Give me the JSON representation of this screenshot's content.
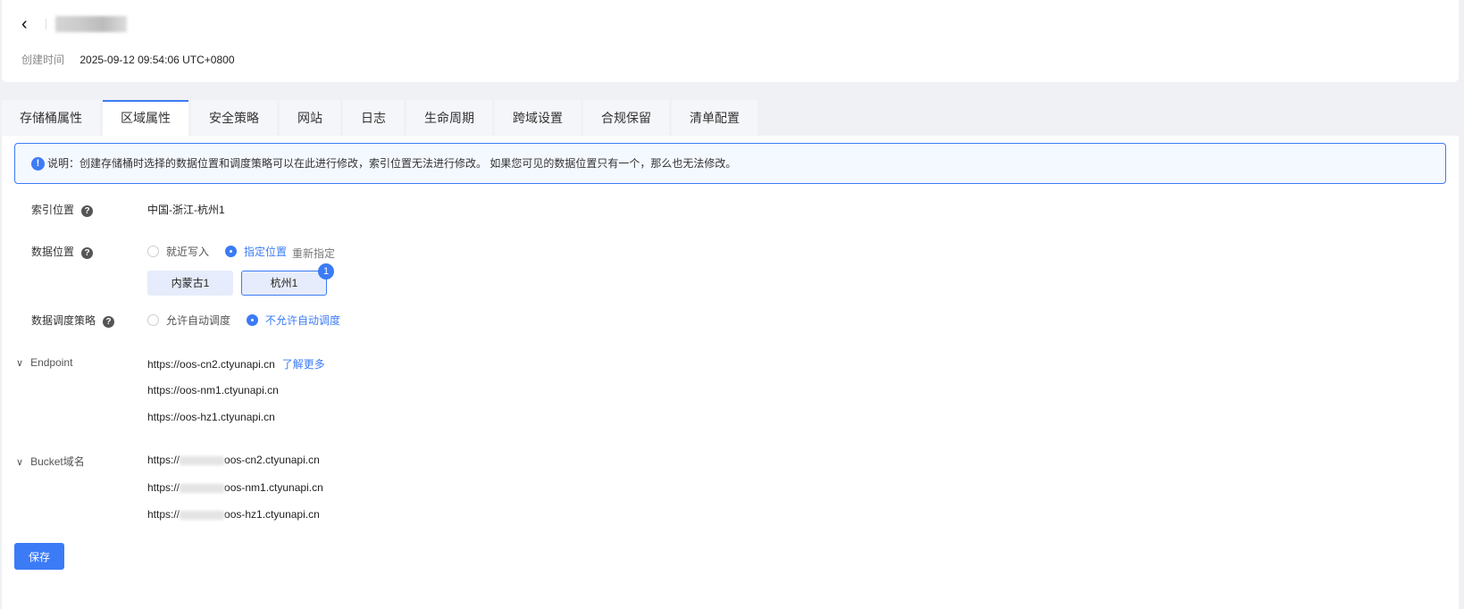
{
  "header": {
    "back_label": "<",
    "created_label": "创建时间",
    "created_value": "2025-09-12 09:54:06 UTC+0800"
  },
  "tabs": [
    "存储桶属性",
    "区域属性",
    "安全策略",
    "网站",
    "日志",
    "生命周期",
    "跨域设置",
    "合规保留",
    "清单配置"
  ],
  "notice": "说明：创建存储桶时选择的数据位置和调度策略可以在此进行修改，索引位置无法进行修改。 如果您可见的数据位置只有一个，那么也无法修改。",
  "index_location": {
    "label": "索引位置",
    "value": "中国-浙江-杭州1"
  },
  "data_location": {
    "label": "数据位置",
    "options": [
      "就近写入",
      "指定位置"
    ],
    "reassign": "重新指定",
    "locations": [
      "内蒙古1",
      "杭州1"
    ],
    "badge": "1"
  },
  "schedule": {
    "label": "数据调度策略",
    "options": [
      "允许自动调度",
      "不允许自动调度"
    ]
  },
  "endpoint": {
    "label": "Endpoint",
    "learn_more": "了解更多",
    "urls": [
      "https://oos-cn2.ctyunapi.cn",
      "https://oos-nm1.ctyunapi.cn",
      "https://oos-hz1.ctyunapi.cn"
    ]
  },
  "bucket_domain": {
    "label": "Bucket域名",
    "prefix": "https://",
    "suffixes": [
      "oos-cn2.ctyunapi.cn",
      "oos-nm1.ctyunapi.cn",
      "oos-hz1.ctyunapi.cn"
    ]
  },
  "save_label": "保存"
}
